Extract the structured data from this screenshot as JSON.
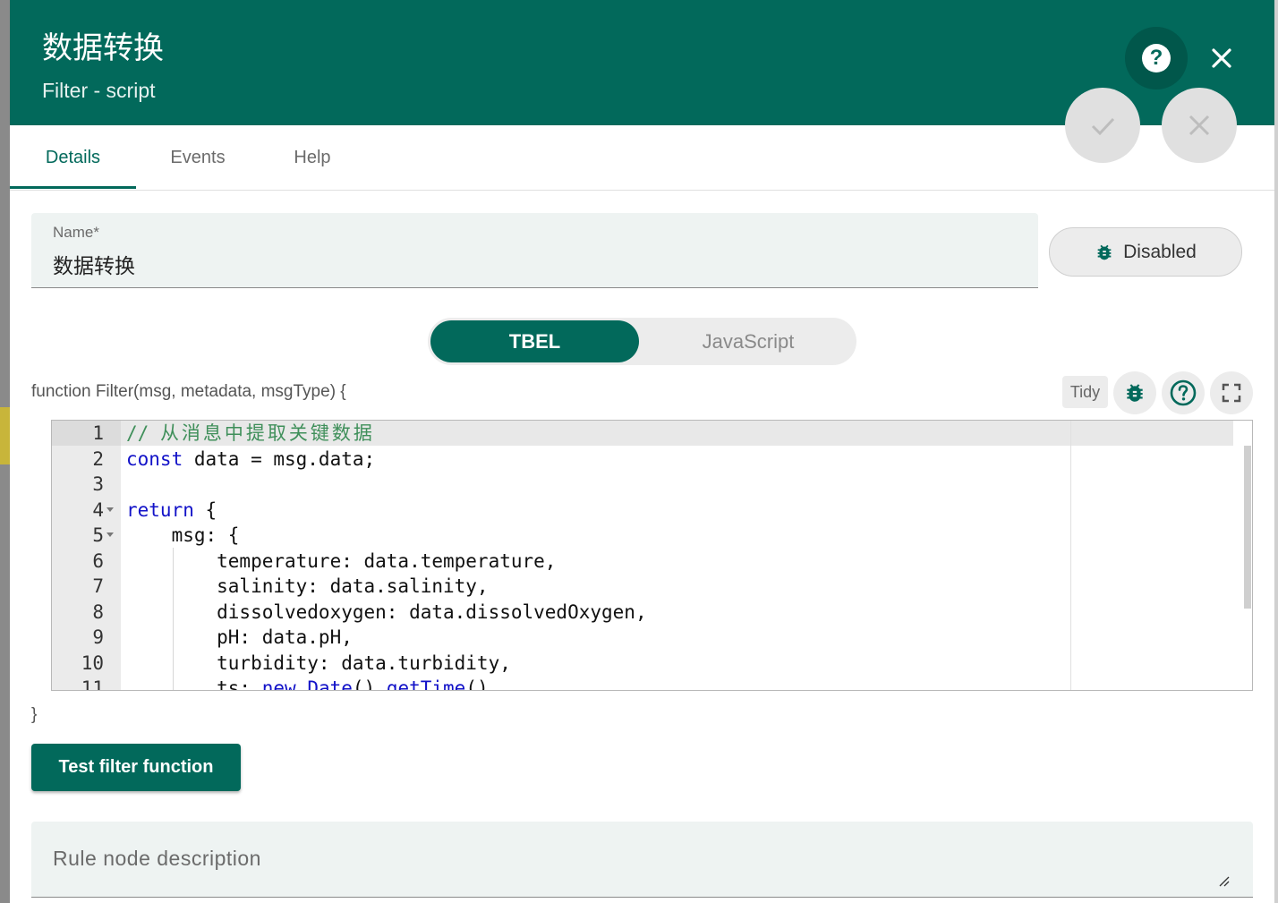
{
  "header": {
    "title": "数据转换",
    "subtitle": "Filter - script",
    "help_icon": "help-circle-icon",
    "close_icon": "close-icon",
    "apply_icon": "check-icon",
    "cancel_icon": "close-icon"
  },
  "tabs": [
    {
      "label": "Details",
      "active": true
    },
    {
      "label": "Events",
      "active": false
    },
    {
      "label": "Help",
      "active": false
    }
  ],
  "name_field": {
    "label": "Name*",
    "value": "数据转换"
  },
  "debug_button": {
    "label": "Disabled",
    "icon": "bug-icon"
  },
  "language_toggle": {
    "options": [
      "TBEL",
      "JavaScript"
    ],
    "selected": "TBEL"
  },
  "script": {
    "signature": "function Filter(msg, metadata, msgType) {",
    "closing": "}",
    "tidy_label": "Tidy",
    "toolbar_icons": [
      "bug-icon",
      "help-circle-icon",
      "fullscreen-icon"
    ],
    "lines": [
      {
        "n": "1",
        "text": "// 从消息中提取关键数据"
      },
      {
        "n": "2",
        "text": "const data = msg.data;"
      },
      {
        "n": "3",
        "text": ""
      },
      {
        "n": "4",
        "text": "return {",
        "fold": true
      },
      {
        "n": "5",
        "text": "    msg: {",
        "fold": true
      },
      {
        "n": "6",
        "text": "        temperature: data.temperature,"
      },
      {
        "n": "7",
        "text": "        salinity: data.salinity,"
      },
      {
        "n": "8",
        "text": "        dissolvedoxygen: data.dissolvedOxygen,"
      },
      {
        "n": "9",
        "text": "        pH: data.pH,"
      },
      {
        "n": "10",
        "text": "        turbidity: data.turbidity,"
      },
      {
        "n": "11",
        "text": "        ts: new Date().getTime()"
      }
    ]
  },
  "test_button": {
    "label": "Test filter function"
  },
  "description": {
    "placeholder": "Rule node description"
  },
  "colors": {
    "primary": "#02695b",
    "field_bg": "#eef3f2",
    "keyword": "#1212c8",
    "comment": "#3f8f5a"
  }
}
